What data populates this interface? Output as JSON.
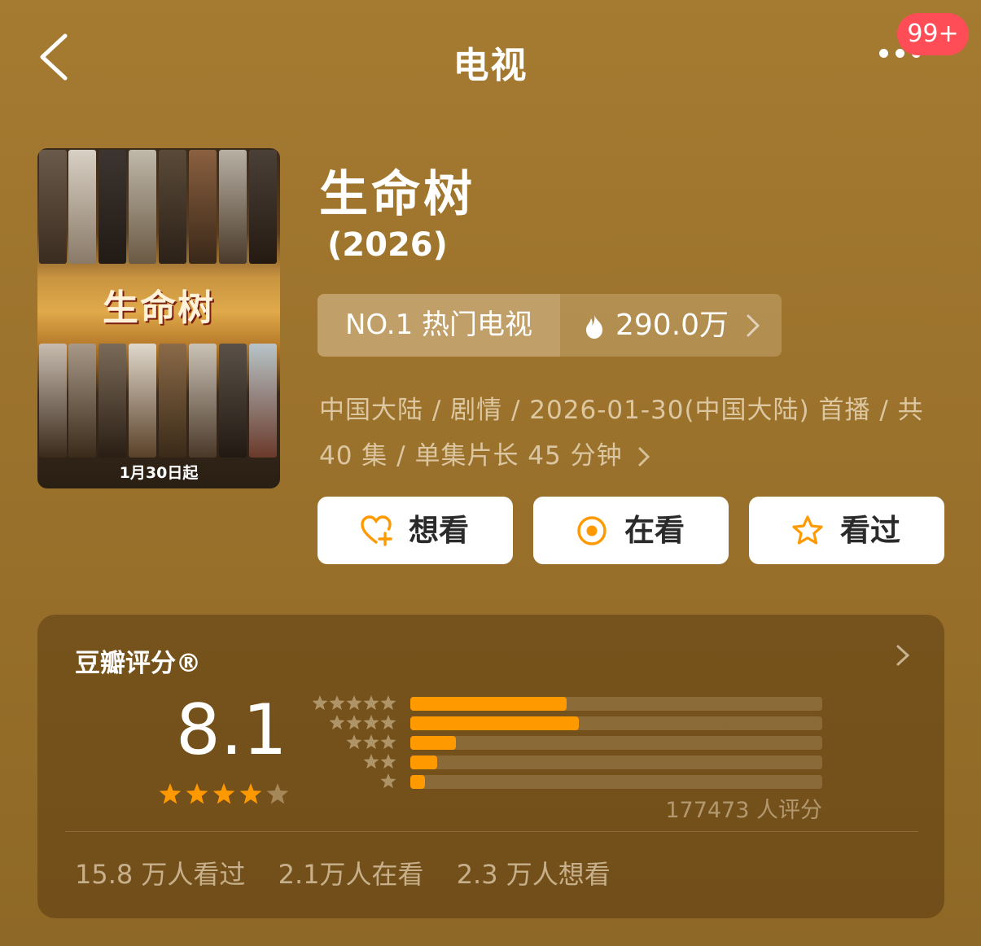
{
  "header": {
    "title": "电视",
    "notification_badge": "99+"
  },
  "poster": {
    "title_art": "生命树",
    "date_text": "1月30日起"
  },
  "show": {
    "title": "生命树",
    "year": "(2026)",
    "rank_label": "NO.1 热门电视",
    "heat_value": "290.0万",
    "meta_line1": "中国大陆 / 剧情 / 2026-01-30(中国大陆) 首播 / 共",
    "meta_line2": "40 集 / 单集片长 45 分钟"
  },
  "actions": {
    "want_label": "想看",
    "watching_label": "在看",
    "watched_label": "看过"
  },
  "rating": {
    "card_title": "豆瓣评分®",
    "score": "8.1",
    "stars": 4,
    "distribution": [
      {
        "stars": 5,
        "fraction": 0.38
      },
      {
        "stars": 4,
        "fraction": 0.41
      },
      {
        "stars": 3,
        "fraction": 0.11
      },
      {
        "stars": 2,
        "fraction": 0.065
      },
      {
        "stars": 1,
        "fraction": 0.035
      }
    ],
    "count_text": "177473 人评分",
    "watched_text": "15.8 万人看过",
    "watching_text": "2.1万人在看",
    "want_text": "2.3 万人想看"
  },
  "colors": {
    "accent": "#ff9900",
    "badge": "#ff4d57",
    "background": "#9b722c"
  }
}
